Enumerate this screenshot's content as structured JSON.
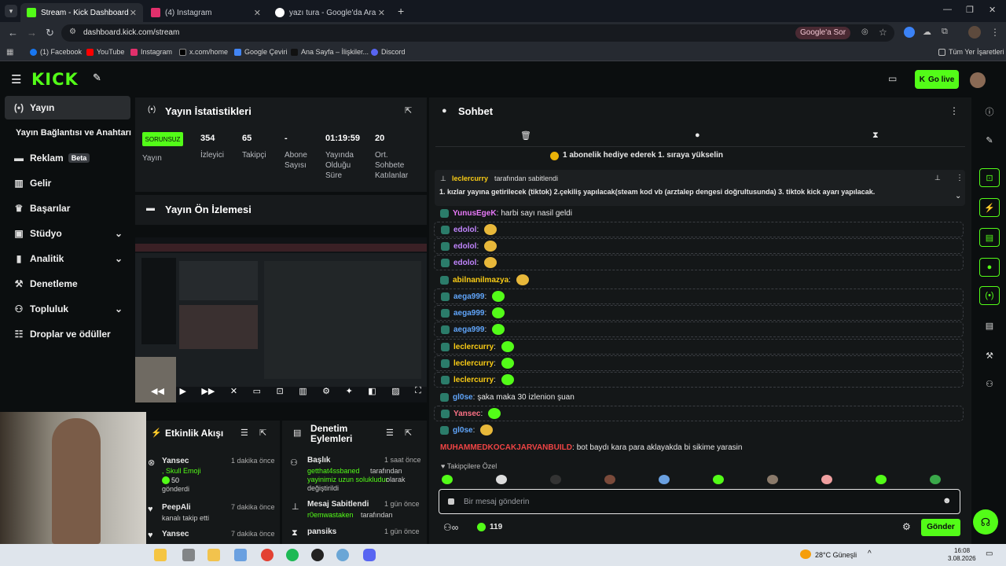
{
  "browser": {
    "tabs": [
      {
        "title": "Stream - Kick Dashboard"
      },
      {
        "title": "(4) Instagram"
      },
      {
        "title": "yazı tura - Google'da Ara"
      }
    ],
    "url": "dashboard.kick.com/stream",
    "google_sor": "Google'a Sor",
    "bookmarks": [
      "(1) Facebook",
      "YouTube",
      "Instagram",
      "x.com/home",
      "Google Çeviri",
      "Ana Sayfa – İlişkiler...",
      "Discord"
    ],
    "all_bookmarks": "Tüm Yer İşaretleri"
  },
  "header": {
    "logo": "KICK",
    "go_live": "Go live"
  },
  "sidebar": {
    "items": [
      {
        "label": "Yayın"
      },
      {
        "label": "Yayın Bağlantısı ve Anahtarı"
      },
      {
        "label": "Reklam",
        "badge": "Beta"
      },
      {
        "label": "Gelir"
      },
      {
        "label": "Başarılar"
      },
      {
        "label": "Stüdyo"
      },
      {
        "label": "Analitik"
      },
      {
        "label": "Denetleme"
      },
      {
        "label": "Topluluk"
      },
      {
        "label": "Droplar ve ödüller"
      }
    ]
  },
  "stats": {
    "title": "Yayın İstatistikleri",
    "status": "SORUNSUZ",
    "status_label": "Yayın",
    "items": [
      {
        "value": "354",
        "label": "İzleyici"
      },
      {
        "value": "65",
        "label": "Takipçi"
      },
      {
        "value": "-",
        "label": "Abone Sayısı"
      },
      {
        "value": "01:19:59",
        "label": "Yayında Olduğu Süre"
      },
      {
        "value": "20",
        "label": "Ort. Sohbete Katılanlar"
      }
    ]
  },
  "preview": {
    "title": "Yayın Ön İzlemesi"
  },
  "activity": {
    "title": "Etkinlik Akışı",
    "items": [
      {
        "user": "Yansec",
        "time": "1 dakika önce",
        "detail": ", Skull Emoji",
        "amount": "50",
        "action": "gönderdi"
      },
      {
        "user": "PeepAli",
        "time": "7 dakika önce",
        "detail": "kanalı takip etti"
      },
      {
        "user": "Yansec",
        "time": "7 dakika önce"
      }
    ]
  },
  "moderation": {
    "title": "Denetim Eylemleri",
    "items": [
      {
        "label": "Başlık",
        "time": "1 saat önce",
        "user": "getthat4ssbaned",
        "detail1": "tarafından",
        "detail2": "yayinimiz uzun solukludur",
        "detail3": "olarak değiştirildi"
      },
      {
        "label": "Mesaj Sabitlendi",
        "time": "1 gün önce",
        "user": "r0emwastaken",
        "detail1": "tarafından"
      },
      {
        "label": "pansiks",
        "time": "1 gün önce"
      }
    ]
  },
  "chat": {
    "title": "Sohbet",
    "sub_banner": "1 abonelik hediye ederek 1. sıraya yükselin",
    "pinned_by_user": "leclercurry",
    "pinned_by_text": "tarafından sabitlendi",
    "pinned_message": "1. kızlar yayına getirilecek (tiktok) 2.çekiliş yapılacak(steam kod vb (arztalep dengesi doğrultusunda) 3. tiktok kick ayarı yapılacak.",
    "messages": [
      {
        "user": "YunusEgeK",
        "text": "harbi sayı nasil geldi",
        "color": "#e879f9",
        "emote": ""
      },
      {
        "user": "edolol",
        "text": "",
        "color": "#c084fc",
        "emote": "gold"
      },
      {
        "user": "edolol",
        "text": "",
        "color": "#c084fc",
        "emote": "gold"
      },
      {
        "user": "edolol",
        "text": "",
        "color": "#c084fc",
        "emote": "gold"
      },
      {
        "user": "abilnanilmazya",
        "text": "",
        "color": "#facc15",
        "emote": "gold"
      },
      {
        "user": "aega999",
        "text": "",
        "color": "#60a5fa",
        "emote": "green"
      },
      {
        "user": "aega999",
        "text": "",
        "color": "#60a5fa",
        "emote": "green"
      },
      {
        "user": "aega999",
        "text": "",
        "color": "#60a5fa",
        "emote": "green"
      },
      {
        "user": "leclercurry",
        "text": "",
        "color": "#facc15",
        "emote": "green"
      },
      {
        "user": "leclercurry",
        "text": "",
        "color": "#facc15",
        "emote": "green"
      },
      {
        "user": "leclercurry",
        "text": "",
        "color": "#facc15",
        "emote": "green"
      },
      {
        "user": "gl0se",
        "text": "şaka maka 30 izlenion şuan",
        "color": "#60a5fa",
        "emote": ""
      },
      {
        "user": "Yansec",
        "text": "",
        "color": "#fb7185",
        "emote": "green"
      },
      {
        "user": "gl0se",
        "text": "",
        "color": "#60a5fa",
        "emote": "gold"
      },
      {
        "user": "MUHAMMEDKOCAKJARVANBUILD",
        "text": "bot baydı kara para aklayakda bi sikime yarasin",
        "color": "#ef4444",
        "emote": ""
      }
    ],
    "emote_section": "Takipçilere Özel",
    "input_placeholder": "Bir mesaj gönderin",
    "viewer_count": "119",
    "send": "Gönder"
  },
  "taskbar": {
    "weather": "28°C  Güneşli",
    "time": "16:08",
    "date": "3.08.2026"
  }
}
